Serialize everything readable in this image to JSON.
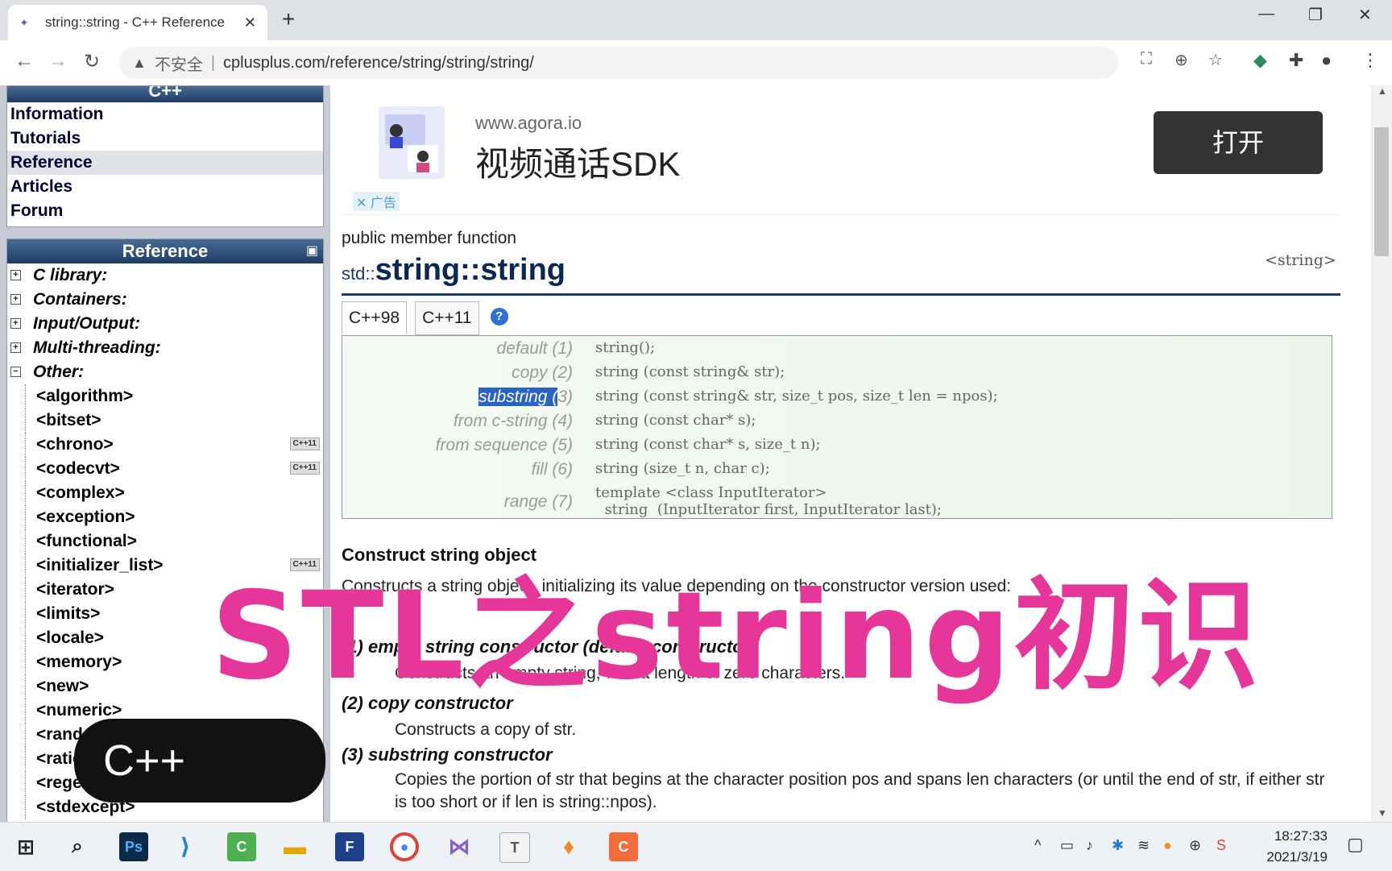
{
  "browser": {
    "tab_title": "string::string - C++ Reference",
    "tab_close": "✕",
    "new_tab": "+",
    "insecure_label": "不安全",
    "url": "cplusplus.com/reference/string/string/string/"
  },
  "sidebar": {
    "top_header": "C++",
    "nav_items": [
      {
        "label": "Information"
      },
      {
        "label": "Tutorials"
      },
      {
        "label": "Reference"
      },
      {
        "label": "Articles"
      },
      {
        "label": "Forum"
      }
    ],
    "active_nav": "Reference",
    "reference_header": "Reference",
    "categories": [
      {
        "label": "C library:",
        "toggle": "+"
      },
      {
        "label": "Containers:",
        "toggle": "+"
      },
      {
        "label": "Input/Output:",
        "toggle": "+"
      },
      {
        "label": "Multi-threading:",
        "toggle": "+"
      },
      {
        "label": "Other:",
        "toggle": "−"
      }
    ],
    "headers": [
      {
        "label": "<algorithm>",
        "badge": ""
      },
      {
        "label": "<bitset>",
        "badge": ""
      },
      {
        "label": "<chrono>",
        "badge": "C++11"
      },
      {
        "label": "<codecvt>",
        "badge": "C++11"
      },
      {
        "label": "<complex>",
        "badge": ""
      },
      {
        "label": "<exception>",
        "badge": ""
      },
      {
        "label": "<functional>",
        "badge": ""
      },
      {
        "label": "<initializer_list>",
        "badge": "C++11"
      },
      {
        "label": "<iterator>",
        "badge": ""
      },
      {
        "label": "<limits>",
        "badge": ""
      },
      {
        "label": "<locale>",
        "badge": ""
      },
      {
        "label": "<memory>",
        "badge": ""
      },
      {
        "label": "<new>",
        "badge": ""
      },
      {
        "label": "<numeric>",
        "badge": ""
      },
      {
        "label": "<random>",
        "badge": ""
      },
      {
        "label": "<ratio>",
        "badge": ""
      },
      {
        "label": "<regex>",
        "badge": ""
      },
      {
        "label": "<stdexcept>",
        "badge": ""
      }
    ]
  },
  "ad": {
    "domain": "www.agora.io",
    "title": "视频通话SDK",
    "button": "打开",
    "close_label": "✕ 广告"
  },
  "page": {
    "member_type": "public member function",
    "namespace": "std::",
    "function_name": "string::string",
    "header_ref": "<string>",
    "version_tabs": [
      "C++98",
      "C++11"
    ],
    "help": "?",
    "prototypes": [
      {
        "label": "default (1)",
        "code": "string();"
      },
      {
        "label": "copy (2)",
        "code": "string (const string& str);"
      },
      {
        "label": "substring (3)",
        "code": "string (const string& str, size_t pos, size_t len = npos);"
      },
      {
        "label": "from c-string (4)",
        "code": "string (const char* s);"
      },
      {
        "label": "from sequence (5)",
        "code": "string (const char* s, size_t n);"
      },
      {
        "label": "fill (6)",
        "code": "string (size_t n, char c);"
      },
      {
        "label": "range (7)",
        "code": "template <class InputIterator>\n  string  (InputIterator first, InputIterator last);"
      }
    ],
    "selected_text": "substring (",
    "section_heading": "Construct string object",
    "section_desc": "Constructs a string object, initializing its value depending on the constructor version used:",
    "items": [
      {
        "heading": "(1) empty string constructor (default constructor)",
        "text": "Constructs an empty string, with a length of zero characters."
      },
      {
        "heading": "(2) copy constructor",
        "text": "Constructs a copy of str."
      },
      {
        "heading": "(3) substring constructor",
        "text": "Copies the portion of str that begins at the character position pos and spans len characters (or until the end of str, if either str is too short or if len is string::npos)."
      }
    ]
  },
  "overlay": {
    "title": "STL之string初识",
    "badge": "C++"
  },
  "taskbar": {
    "time": "18:27:33",
    "date": "2021/3/19"
  },
  "colors": {
    "overlay_pink": "#e6369a",
    "sidebar_header": "#1c3d66",
    "selection": "#2a63c8"
  }
}
